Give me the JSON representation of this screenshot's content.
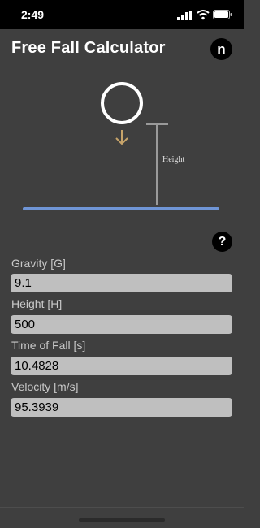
{
  "status_bar": {
    "time": "2:49",
    "icons": [
      "signal-icon",
      "wifi-icon",
      "battery-icon"
    ]
  },
  "header": {
    "title": "Free Fall Calculator",
    "brand_button_label": "n"
  },
  "diagram": {
    "height_label": "Height",
    "colors": {
      "ball_outline": "#ffffff",
      "arrow": "#c7a46a",
      "ground_line": "#6f95d6",
      "height_marker": "#9a9a9a"
    }
  },
  "help_button_label": "?",
  "fields": [
    {
      "label": "Gravity [G]",
      "value": "9.1"
    },
    {
      "label": "Height [H]",
      "value": "500"
    },
    {
      "label": "Time of Fall [s]",
      "value": "10.4828"
    },
    {
      "label": "Velocity [m/s]",
      "value": "95.3939"
    }
  ]
}
